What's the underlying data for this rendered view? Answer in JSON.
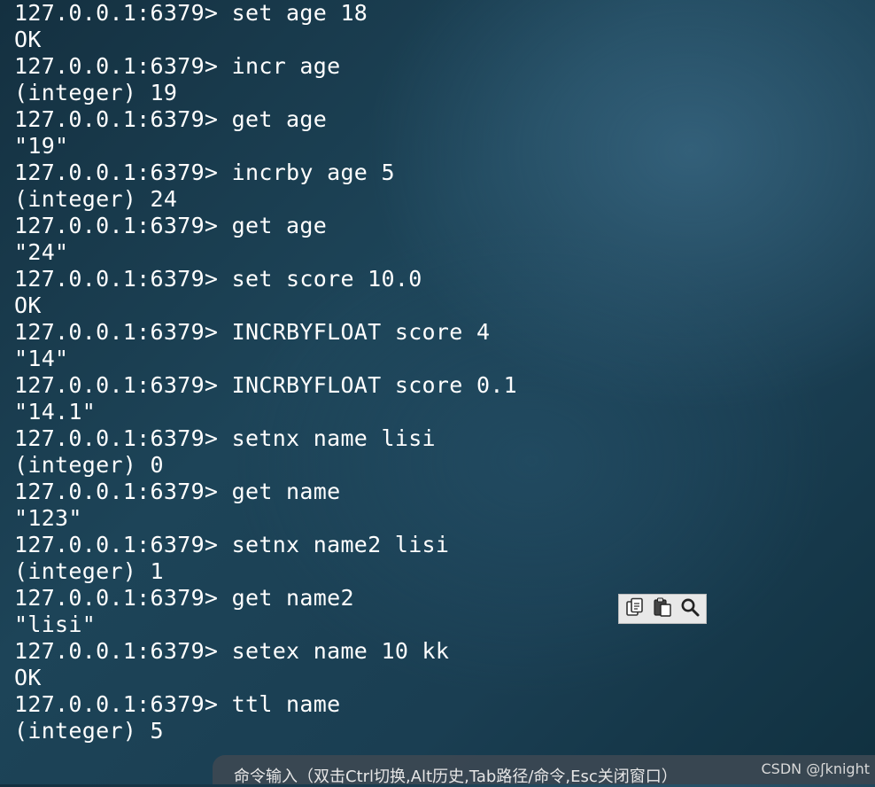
{
  "terminal": {
    "lines": [
      {
        "type": "cmd",
        "prompt": "127.0.0.1:6379>",
        "text": "set age 18"
      },
      {
        "type": "out",
        "text": "OK"
      },
      {
        "type": "cmd",
        "prompt": "127.0.0.1:6379>",
        "text": "incr age"
      },
      {
        "type": "out",
        "text": "(integer) 19"
      },
      {
        "type": "cmd",
        "prompt": "127.0.0.1:6379>",
        "text": "get age"
      },
      {
        "type": "out",
        "text": "\"19\""
      },
      {
        "type": "cmd",
        "prompt": "127.0.0.1:6379>",
        "text": "incrby age 5"
      },
      {
        "type": "out",
        "text": "(integer) 24"
      },
      {
        "type": "cmd",
        "prompt": "127.0.0.1:6379>",
        "text": "get age"
      },
      {
        "type": "out",
        "text": "\"24\""
      },
      {
        "type": "cmd",
        "prompt": "127.0.0.1:6379>",
        "text": "set score 10.0"
      },
      {
        "type": "out",
        "text": "OK"
      },
      {
        "type": "cmd",
        "prompt": "127.0.0.1:6379>",
        "text": "INCRBYFLOAT score 4"
      },
      {
        "type": "out",
        "text": "\"14\""
      },
      {
        "type": "cmd",
        "prompt": "127.0.0.1:6379>",
        "text": "INCRBYFLOAT score 0.1"
      },
      {
        "type": "out",
        "text": "\"14.1\""
      },
      {
        "type": "cmd",
        "prompt": "127.0.0.1:6379>",
        "text": "setnx name lisi"
      },
      {
        "type": "out",
        "text": "(integer) 0"
      },
      {
        "type": "cmd",
        "prompt": "127.0.0.1:6379>",
        "text": "get name"
      },
      {
        "type": "out",
        "text": "\"123\""
      },
      {
        "type": "cmd",
        "prompt": "127.0.0.1:6379>",
        "text": "setnx name2 lisi"
      },
      {
        "type": "out",
        "text": "(integer) 1"
      },
      {
        "type": "cmd",
        "prompt": "127.0.0.1:6379>",
        "text": "get name2"
      },
      {
        "type": "out",
        "text": "\"lisi\""
      },
      {
        "type": "cmd",
        "prompt": "127.0.0.1:6379>",
        "text": "setex name 10 kk"
      },
      {
        "type": "out",
        "text": "OK"
      },
      {
        "type": "cmd",
        "prompt": "127.0.0.1:6379>",
        "text": "ttl name"
      },
      {
        "type": "out",
        "text": "(integer) 5"
      }
    ]
  },
  "toolbar": {
    "buttons": [
      {
        "name": "copy-icon"
      },
      {
        "name": "paste-icon"
      },
      {
        "name": "search-icon"
      }
    ]
  },
  "statusbar": {
    "hint": "命令输入（双击Ctrl切换,Alt历史,Tab路径/命令,Esc关闭窗口）",
    "watermark": "CSDN @ʃknight"
  },
  "colors": {
    "text": "#ffffff",
    "toolbar_bg": "#e8e8e8",
    "statusbar_bg": "#3c4852"
  }
}
